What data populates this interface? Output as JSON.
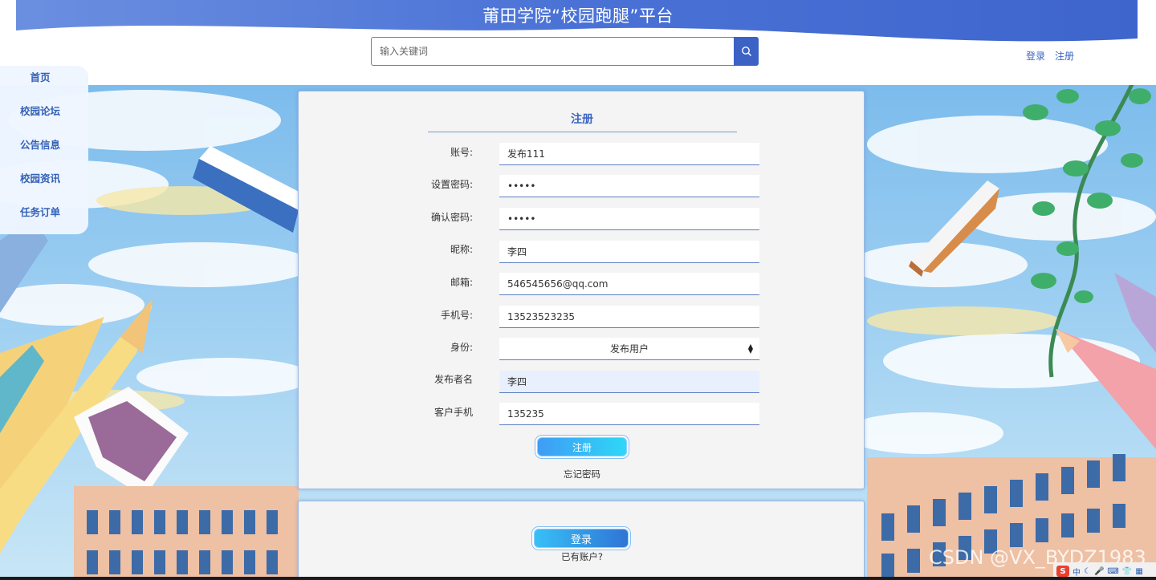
{
  "header": {
    "title": "莆田学院“校园跑腿”平台",
    "search_placeholder": "输入关键词",
    "login_link": "登录",
    "register_link": "注册"
  },
  "sidebar": {
    "items": [
      {
        "label": "首页"
      },
      {
        "label": "校园论坛"
      },
      {
        "label": "公告信息"
      },
      {
        "label": "校园资讯"
      },
      {
        "label": "任务订单"
      }
    ]
  },
  "form": {
    "title": "注册",
    "fields": [
      {
        "label": "账号:",
        "value": "发布111"
      },
      {
        "label": "设置密码:",
        "value": "•••••"
      },
      {
        "label": "确认密码:",
        "value": "•••••"
      },
      {
        "label": "昵称:",
        "value": "李四"
      },
      {
        "label": "邮箱:",
        "value": "546545656@qq.com"
      },
      {
        "label": "手机号:",
        "value": "13523523235"
      },
      {
        "label": "身份:",
        "value": "发布用户"
      },
      {
        "label": "发布者名",
        "value": "李四"
      },
      {
        "label": "客户手机",
        "value": "135235"
      }
    ],
    "submit_label": "注册",
    "forgot_label": "忘记密码"
  },
  "login_card": {
    "login_label": "登录",
    "has_account": "已有账户?"
  },
  "watermark": "CSDN @VX_BYDZ1983",
  "tray": {
    "ime": "S",
    "lang": "中"
  },
  "colors": {
    "accent": "#3a63c3",
    "title_band": "#4b72d3",
    "sky": "#8fc6ee"
  }
}
